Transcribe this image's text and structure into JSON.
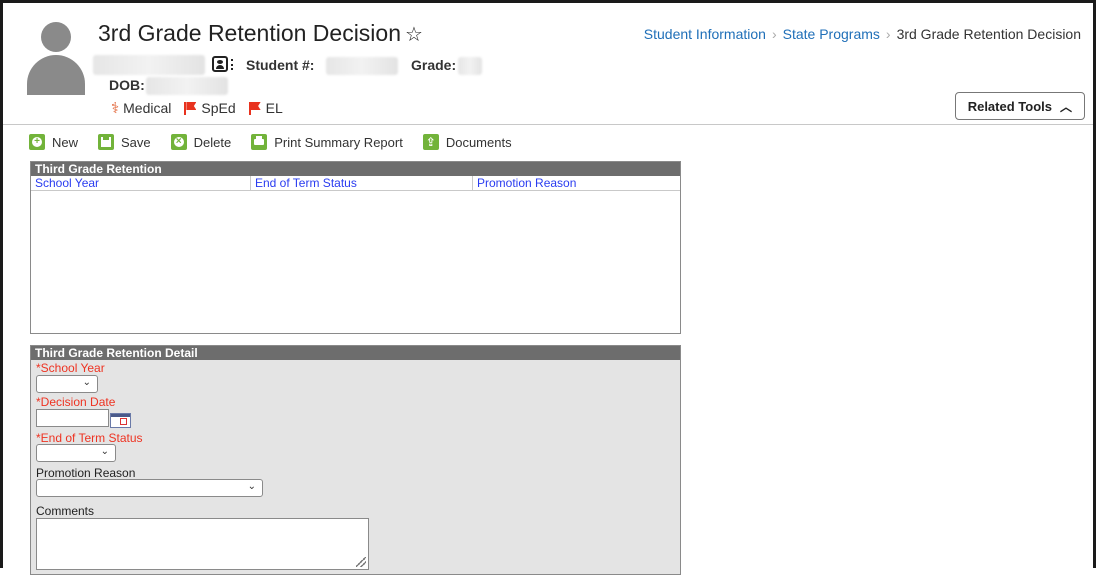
{
  "header": {
    "title": "3rd Grade Retention Decision",
    "favorite_icon": "star-outline-icon",
    "student_number_label": "Student #:",
    "grade_label": "Grade:",
    "dob_label": "DOB:",
    "contact_card_icon": "contact-card-icon",
    "flags": [
      {
        "label": "Medical",
        "icon": "medical-icon",
        "color": "#e05a2a"
      },
      {
        "label": "SpEd",
        "icon": "flag-icon",
        "color": "#e8321e"
      },
      {
        "label": "EL",
        "icon": "flag-icon",
        "color": "#e8321e"
      }
    ],
    "related_tools": {
      "label": "Related Tools",
      "icon": "chevron-up-icon"
    }
  },
  "breadcrumb": {
    "items": [
      "Student Information",
      "State Programs",
      "3rd Grade Retention Decision"
    ]
  },
  "toolbar": {
    "new_label": "New",
    "save_label": "Save",
    "delete_label": "Delete",
    "print_label": "Print Summary Report",
    "documents_label": "Documents",
    "accent_color": "#72b33a"
  },
  "list_panel": {
    "title": "Third Grade Retention",
    "columns": [
      "School Year",
      "End of Term Status",
      "Promotion Reason"
    ],
    "rows": []
  },
  "detail_panel": {
    "title": "Third Grade Retention Detail",
    "school_year_label": "*School Year",
    "school_year_value": "",
    "decision_date_label": "*Decision Date",
    "decision_date_value": "",
    "end_of_term_label": "*End of Term Status",
    "end_of_term_value": "",
    "promotion_reason_label": "Promotion Reason",
    "promotion_reason_value": "",
    "comments_label": "Comments",
    "comments_value": "",
    "required_color": "#e32222"
  }
}
